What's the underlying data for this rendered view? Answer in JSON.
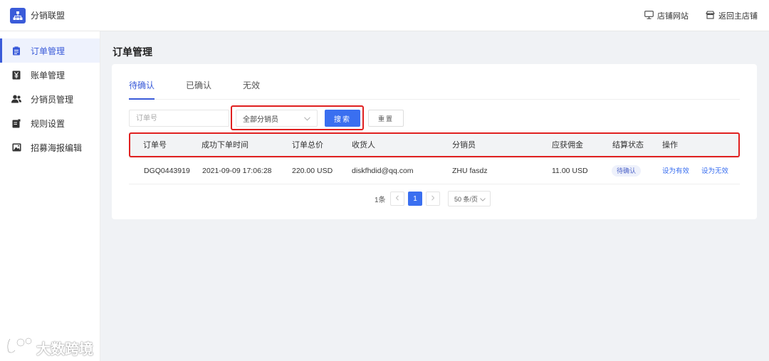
{
  "header": {
    "brand": "分销联盟",
    "store_site": "店铺网站",
    "back_to_store": "返回主店铺"
  },
  "sidebar": {
    "items": [
      {
        "label": "订单管理",
        "icon": "clipboard-icon",
        "active": true
      },
      {
        "label": "账单管理",
        "icon": "yen-icon"
      },
      {
        "label": "分销员管理",
        "icon": "users-icon"
      },
      {
        "label": "规则设置",
        "icon": "document-edit-icon"
      },
      {
        "label": "招募海报编辑",
        "icon": "image-icon"
      }
    ]
  },
  "page": {
    "title": "订单管理"
  },
  "tabs": [
    {
      "label": "待确认",
      "active": true
    },
    {
      "label": "已确认"
    },
    {
      "label": "无效"
    }
  ],
  "filters": {
    "order_placeholder": "订单号",
    "distributor_select": "全部分销员",
    "search_label": "搜索",
    "reset_label": "重置"
  },
  "table": {
    "headers": [
      "订单号",
      "成功下单时间",
      "订单总价",
      "收货人",
      "分销员",
      "应获佣金",
      "结算状态",
      "操作"
    ],
    "rows": [
      {
        "order_no": "DGQ0443919",
        "time": "2021-09-09 17:06:28",
        "total": "220.00 USD",
        "receiver": "diskfhdid@qq.com",
        "distributor": "ZHU fasdz",
        "commission": "11.00 USD",
        "status": "待确认",
        "action_valid": "设为有效",
        "action_invalid": "设为无效"
      }
    ]
  },
  "pagination": {
    "total": "1条",
    "current_page": "1",
    "page_size": "50 条/页"
  },
  "watermark": {
    "text": "大数跨境"
  },
  "colors": {
    "accent": "#3a5bd9",
    "primary_button": "#3a6ff0",
    "highlight_border": "#e02020"
  }
}
